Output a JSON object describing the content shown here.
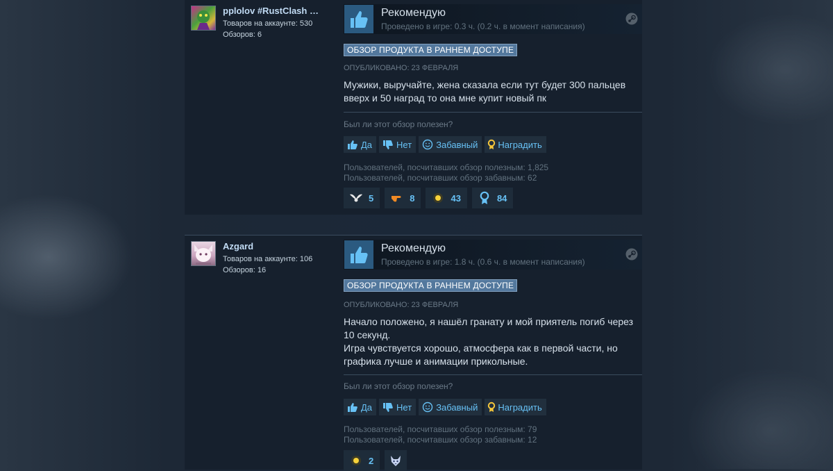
{
  "reviews": [
    {
      "author": {
        "name": "pplolov #RustClash …",
        "products": "Товаров на аккаунте: 530",
        "reviews": "Обзоров: 6"
      },
      "recommend": "Рекомендую",
      "hours": "Проведено в игре: 0.3 ч. (0.2 ч. в момент написания)",
      "early_access": "ОБЗОР ПРОДУКТА В РАННЕМ ДОСТУПЕ",
      "posted": "ОПУБЛИКОВАНО: 23 ФЕВРАЛЯ",
      "body": [
        "Мужики, выручайте, жена сказала если тут будет 300 пальцев",
        "вверх и 50 наград то она мне купит новый пк"
      ],
      "helpful_question": "Был ли этот обзор полезен?",
      "buttons": {
        "yes": "Да",
        "no": "Нет",
        "funny": "Забавный",
        "award": "Наградить"
      },
      "helpful_count": "Пользователей, посчитавших обзор полезным: 1,825",
      "funny_count": "Пользователей, посчитавших обзор забавным: 62",
      "awards": [
        {
          "icon": "wings-award-icon",
          "count": "5"
        },
        {
          "icon": "finger-gun-award-icon",
          "count": "8"
        },
        {
          "icon": "sun-award-icon",
          "count": "43"
        },
        {
          "icon": "ribbon-award-icon",
          "count": "84"
        }
      ]
    },
    {
      "author": {
        "name": "Azgard",
        "products": "Товаров на аккаунте: 106",
        "reviews": "Обзоров: 16"
      },
      "recommend": "Рекомендую",
      "hours": "Проведено в игре: 1.8 ч. (0.6 ч. в момент написания)",
      "early_access": "ОБЗОР ПРОДУКТА В РАННЕМ ДОСТУПЕ",
      "posted": "ОПУБЛИКОВАНО: 23 ФЕВРАЛЯ",
      "body": [
        "Начало положено, я нашёл гранату и мой приятель погиб через",
        "10 секунд.",
        "Игра чувствуется хорошо, атмосфера как в первой части, но",
        "графика лучше и анимации прикольные."
      ],
      "helpful_question": "Был ли этот обзор полезен?",
      "buttons": {
        "yes": "Да",
        "no": "Нет",
        "funny": "Забавный",
        "award": "Наградить"
      },
      "helpful_count": "Пользователей, посчитавших обзор полезным: 79",
      "funny_count": "Пользователей, посчитавших обзор забавным: 12",
      "awards": [
        {
          "icon": "sun-award-icon",
          "count": "2"
        },
        {
          "icon": "wolf-award-icon",
          "count": ""
        }
      ]
    }
  ],
  "colors": {
    "page_bg": "#1b2838",
    "panel_bg": "#16202d",
    "link_blue": "#67c1f5",
    "thumb_bg": "#2b5a80",
    "badge_bg": "#53789d"
  }
}
